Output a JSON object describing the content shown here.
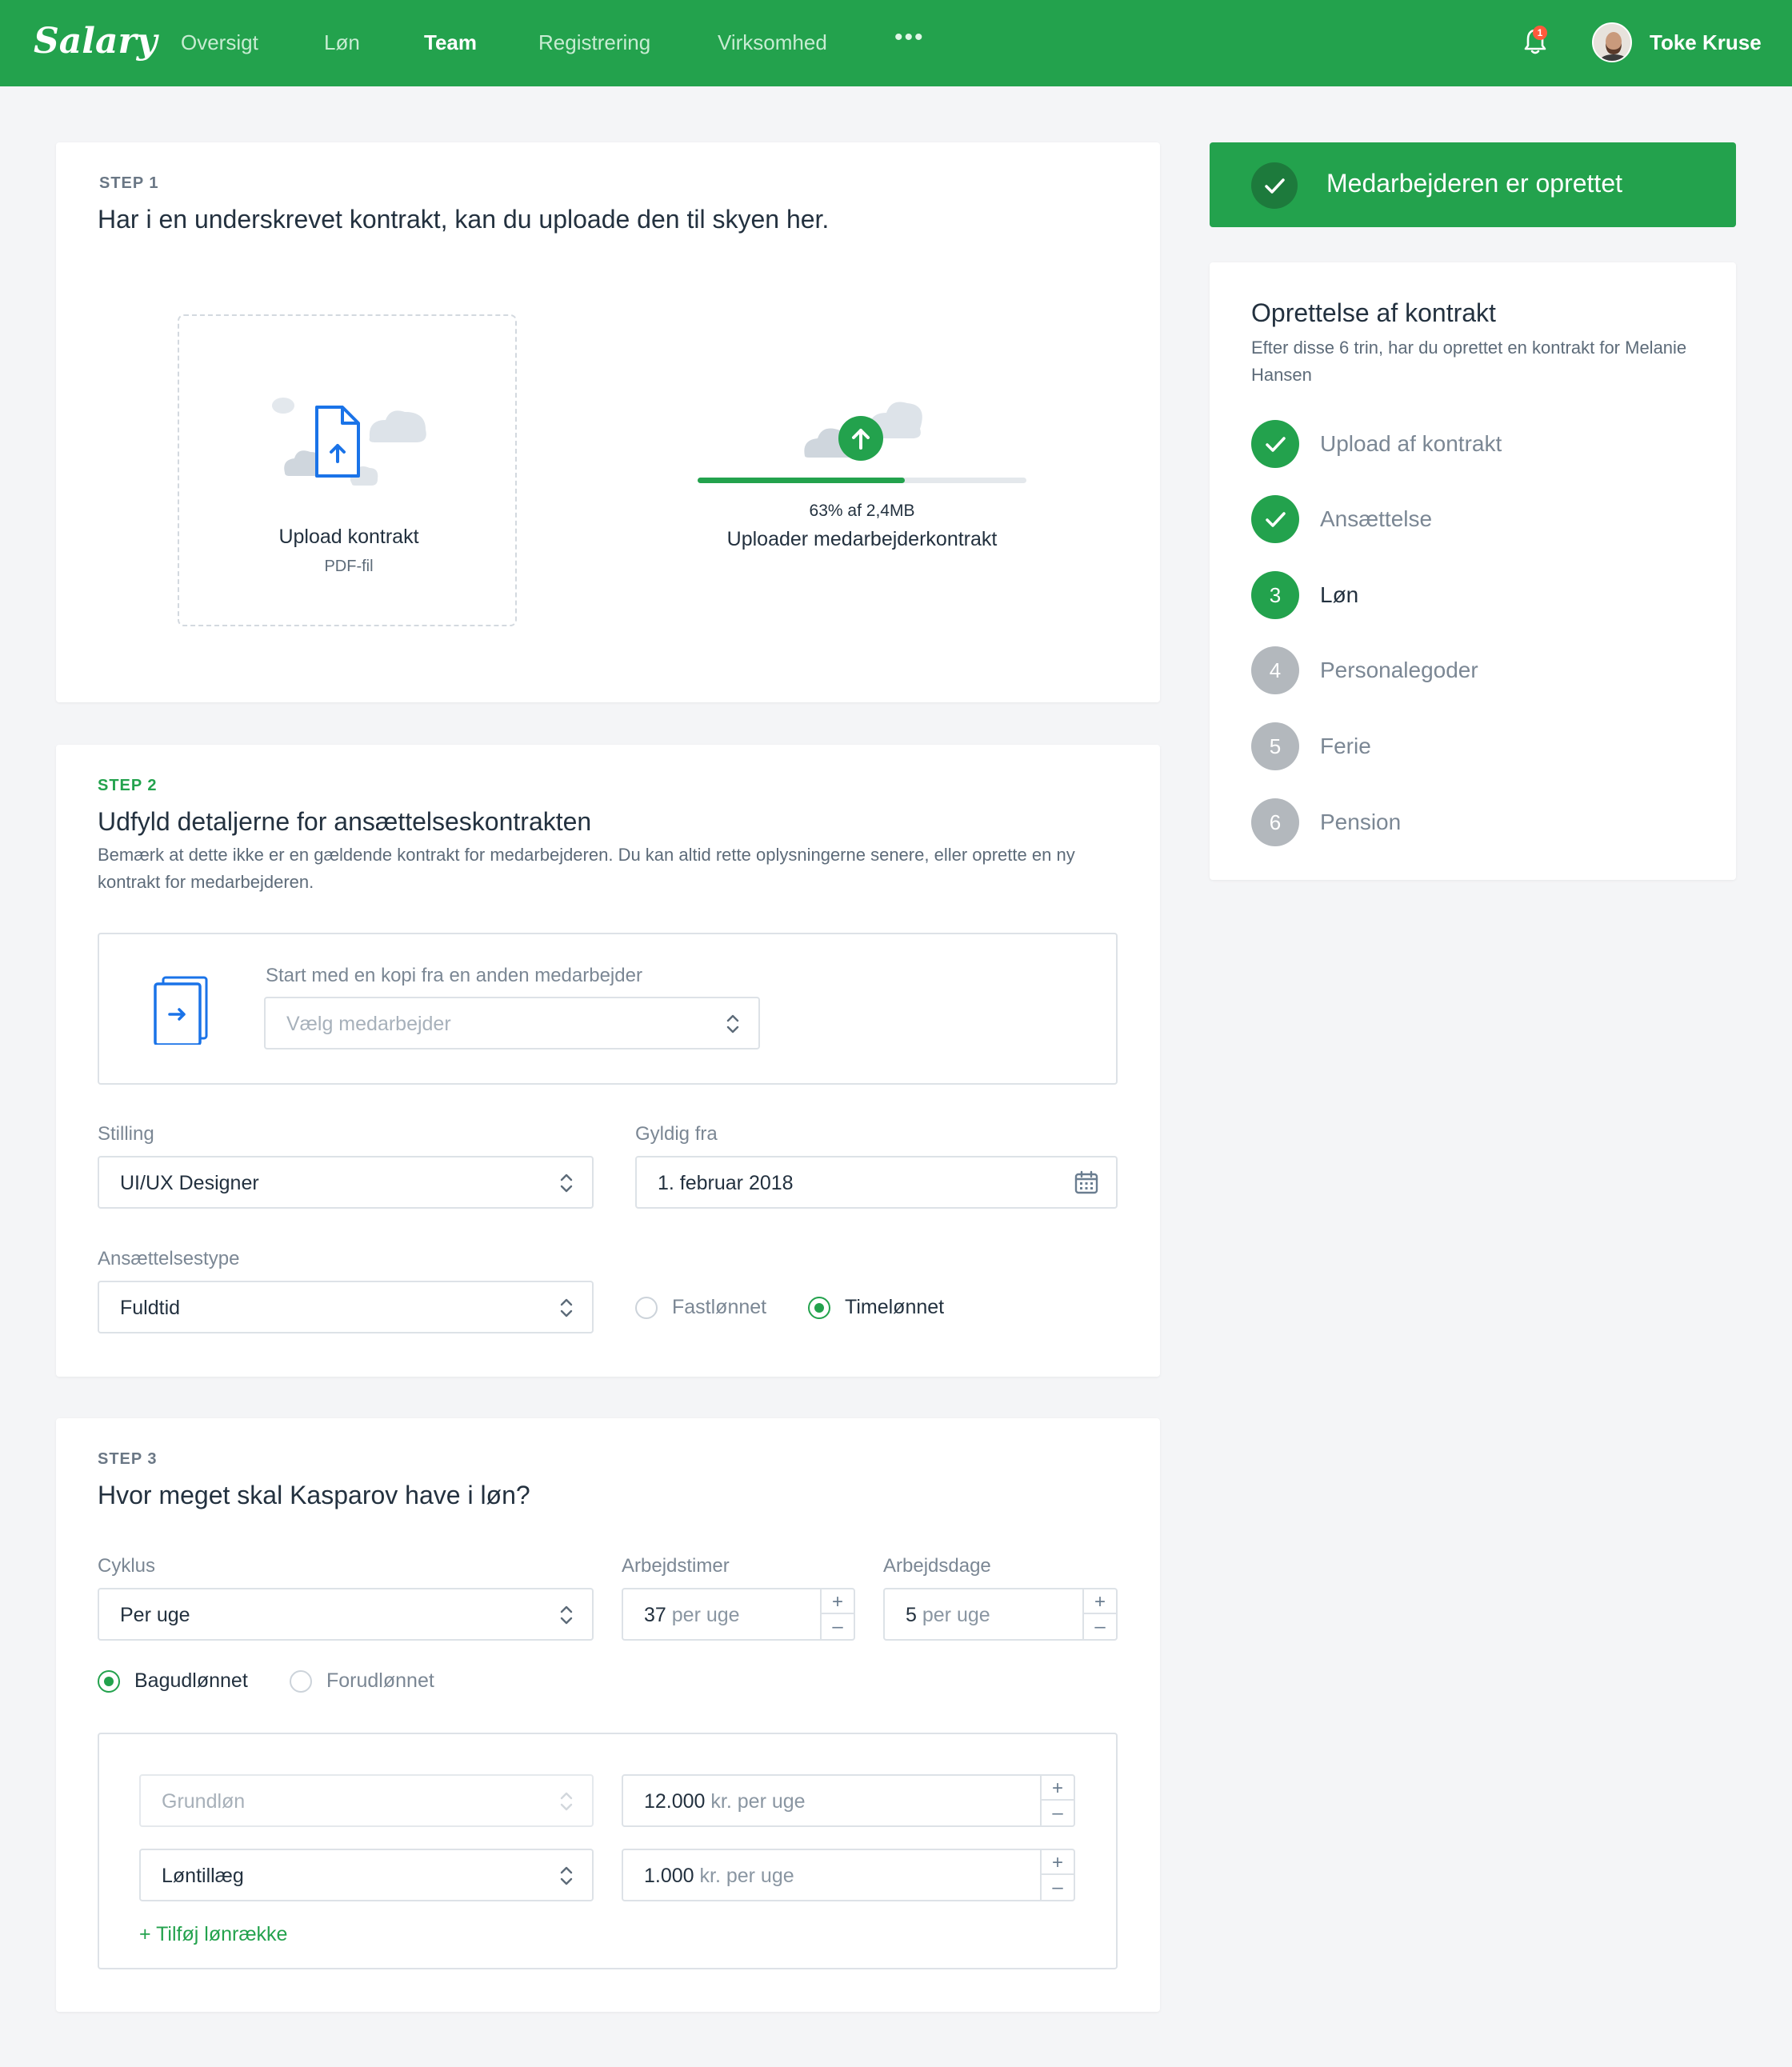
{
  "brand": "Salary",
  "nav": {
    "items": [
      {
        "label": "Oversigt",
        "active": false
      },
      {
        "label": "Løn",
        "active": false
      },
      {
        "label": "Team",
        "active": true
      },
      {
        "label": "Registrering",
        "active": false
      },
      {
        "label": "Virksomhed",
        "active": false
      }
    ],
    "more": "•••",
    "notifications": "1",
    "user": "Toke Kruse"
  },
  "step1": {
    "label": "STEP 1",
    "title": "Har i en underskrevet kontrakt, kan du uploade den til skyen her.",
    "dropzone": {
      "title": "Upload kontrakt",
      "subtitle": "PDF-fil"
    },
    "progress": {
      "percent": 63,
      "info": "63% af 2,4MB",
      "title": "Uploader medarbejderkontrakt"
    }
  },
  "step2": {
    "label": "STEP 2",
    "title": "Udfyld detaljerne for ansættelseskontrakten",
    "description": "Bemærk at dette ikke er en gældende kontrakt for medarbejderen. Du kan altid rette oplysningerne senere, eller oprette en ny kontrakt for medarbejderen.",
    "copy": {
      "label": "Start med en kopi fra en anden medarbejder",
      "placeholder": "Vælg medarbejder"
    },
    "position": {
      "label": "Stilling",
      "value": "UI/UX Designer"
    },
    "valid_from": {
      "label": "Gyldig fra",
      "value": "1. februar 2018"
    },
    "employment_type": {
      "label": "Ansættelsestype",
      "value": "Fuldtid"
    },
    "pay_type": {
      "options": [
        "Fastlønnet",
        "Timelønnet"
      ],
      "selected": "Timelønnet"
    }
  },
  "step3": {
    "label": "STEP 3",
    "title": "Hvor meget skal Kasparov have i løn?",
    "cycle": {
      "label": "Cyklus",
      "value": "Per uge"
    },
    "hours": {
      "label": "Arbejdstimer",
      "value": "37",
      "unit": "per uge"
    },
    "days": {
      "label": "Arbejdsdage",
      "value": "5",
      "unit": "per uge"
    },
    "payment_timing": {
      "options": [
        "Bagudlønnet",
        "Forudlønnet"
      ],
      "selected": "Bagudlønnet"
    },
    "rows": [
      {
        "type": "Grundløn",
        "amount": "12.000",
        "unit": "kr. per uge",
        "disabled": true
      },
      {
        "type": "Løntillæg",
        "amount": "1.000",
        "unit": "kr. per uge",
        "disabled": false
      }
    ],
    "add_row": "+ Tilføj lønrække"
  },
  "sidebar": {
    "banner": "Medarbejderen er oprettet",
    "title": "Oprettelse af kontrakt",
    "description": "Efter disse 6 trin, har du oprettet en kontrakt for Melanie Hansen",
    "steps": [
      {
        "number": "1",
        "label": "Upload af kontrakt",
        "state": "done"
      },
      {
        "number": "2",
        "label": "Ansættelse",
        "state": "done"
      },
      {
        "number": "3",
        "label": "Løn",
        "state": "current"
      },
      {
        "number": "4",
        "label": "Personalegoder",
        "state": "pending"
      },
      {
        "number": "5",
        "label": "Ferie",
        "state": "pending"
      },
      {
        "number": "6",
        "label": "Pension",
        "state": "pending"
      }
    ]
  },
  "colors": {
    "brand": "#23a24d",
    "pending": "#b3b8bd",
    "badge": "#ff5a3c"
  }
}
